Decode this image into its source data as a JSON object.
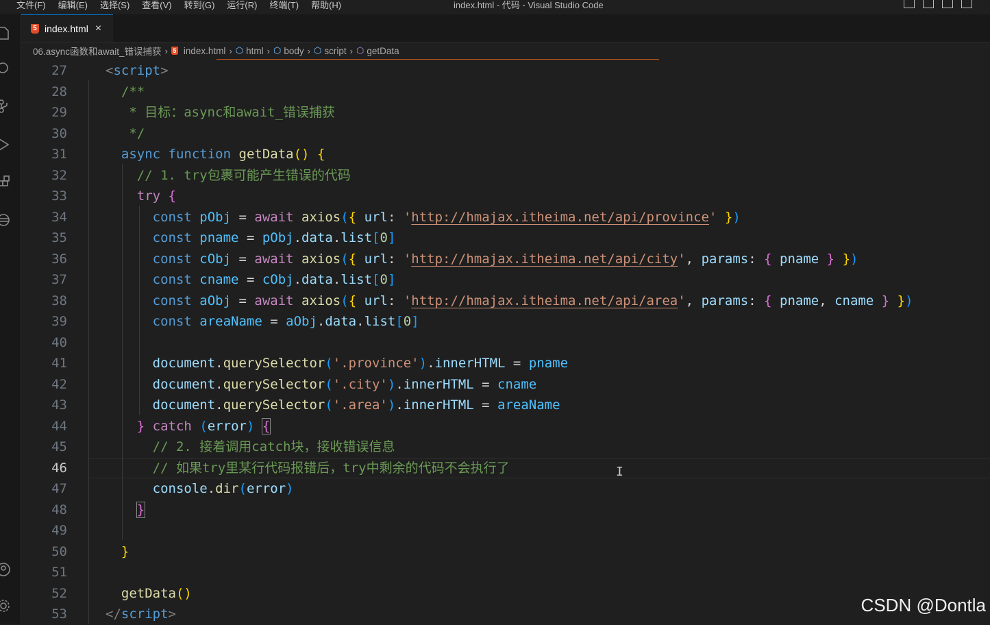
{
  "menu": [
    "文件(F)",
    "编辑(E)",
    "选择(S)",
    "查看(V)",
    "转到(G)",
    "运行(R)",
    "终端(T)",
    "帮助(H)"
  ],
  "window_title": "index.html - 代码 - Visual Studio Code",
  "tab": {
    "label": "index.html",
    "badge": "5",
    "close": "×"
  },
  "breadcrumb": {
    "folder": "06.async函数和await_错误捕获",
    "file": "index.html",
    "symbols": [
      "html",
      "body",
      "script",
      "getData"
    ]
  },
  "editor": {
    "line_numbers": [
      "27",
      "28",
      "29",
      "30",
      "31",
      "32",
      "33",
      "34",
      "35",
      "36",
      "37",
      "38",
      "39",
      "40",
      "41",
      "42",
      "43",
      "44",
      "45",
      "46",
      "47",
      "48",
      "49",
      "50",
      "51",
      "52",
      "53"
    ],
    "active_line": "46",
    "code": {
      "l27_open": "<",
      "l27_tag": "script",
      "l27_close": ">",
      "l28": "/**",
      "l29": " * 目标：async和await_错误捕获",
      "l30": " */",
      "l31_async": "async",
      "l31_function": "function",
      "l31_name": "getData",
      "l31_paren": "()",
      "l31_brace": "{",
      "l32": "// 1. try包裹可能产生错误的代码",
      "l33_try": "try",
      "l33_brace": "{",
      "const": "const",
      "await": "await",
      "axios": "axios",
      "url_key": "url",
      "params_key": "params",
      "url_province": "http://hmajax.itheima.net/api/province",
      "url_city": "http://hmajax.itheima.net/api/city",
      "url_area": "http://hmajax.itheima.net/api/area",
      "pObj": "pObj",
      "cObj": "cObj",
      "aObj": "aObj",
      "pname": "pname",
      "cname": "cname",
      "areaName": "areaName",
      "data": "data",
      "list": "list",
      "zero": "0",
      "document": "document",
      "querySelector": "querySelector",
      "innerHTML": "innerHTML",
      "sel_province": "'.province'",
      "sel_city": "'.city'",
      "sel_area": "'.area'",
      "l44_catch": "catch",
      "l44_error": "error",
      "l45": "// 2. 接着调用catch块，接收错误信息",
      "l46": "// 如果try里某行代码报错后，try中剩余的代码不会执行了",
      "l47_console": "console",
      "l47_dir": "dir",
      "l47_error": "error",
      "l52_call": "getData",
      "l53_open": "</",
      "l53_tag": "script",
      "l53_close": ">"
    }
  },
  "watermark": "CSDN @Dontla"
}
